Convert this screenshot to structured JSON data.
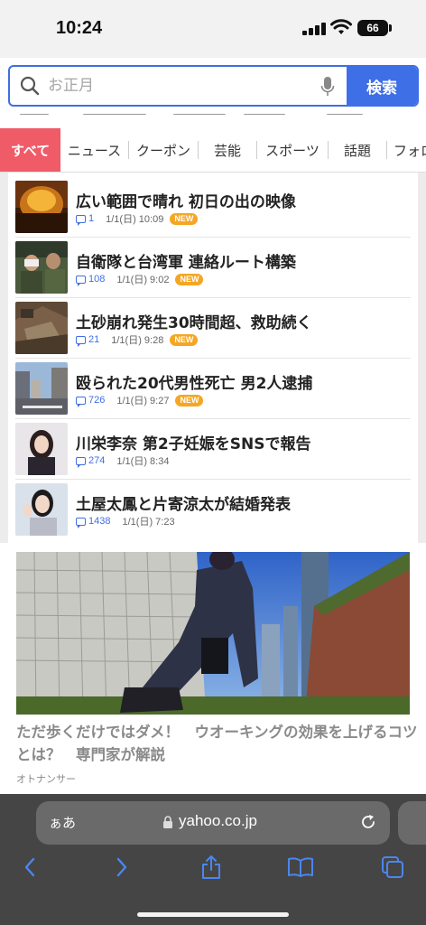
{
  "status_bar": {
    "time": "10:24",
    "battery": "66"
  },
  "search": {
    "placeholder": "お正月",
    "button_label": "検索"
  },
  "tabs": [
    {
      "label": "すべて",
      "active": true
    },
    {
      "label": "ニュース"
    },
    {
      "label": "クーポン"
    },
    {
      "label": "芸能"
    },
    {
      "label": "スポーツ"
    },
    {
      "label": "話題"
    },
    {
      "label": "フォロ"
    }
  ],
  "news": [
    {
      "title": "広い範囲で晴れ 初日の出の映像",
      "comments": "1",
      "date": "1/1(日) 10:09",
      "new": "NEW"
    },
    {
      "title": "自衛隊と台湾軍 連絡ルート構築",
      "comments": "108",
      "date": "1/1(日) 9:02",
      "new": "NEW"
    },
    {
      "title": "土砂崩れ発生30時間超、救助続く",
      "comments": "21",
      "date": "1/1(日) 9:28",
      "new": "NEW"
    },
    {
      "title": "殴られた20代男性死亡 男2人逮捕",
      "comments": "726",
      "date": "1/1(日) 9:27",
      "new": "NEW"
    },
    {
      "title": "川栄李奈 第2子妊娠をSNSで報告",
      "comments": "274",
      "date": "1/1(日) 8:34"
    },
    {
      "title": "土屋太鳳と片寄涼太が結婚発表",
      "comments": "1438",
      "date": "1/1(日) 7:23"
    }
  ],
  "feature": {
    "title": "ただ歩くだけではダメ！　ウオーキングの効果を上げるコツとは？　専門家が解説",
    "source": "オトナンサー"
  },
  "browser": {
    "aa_label": "ぁあ",
    "url": "yahoo.co.jp"
  },
  "colors": {
    "accent_blue": "#3f6fe6",
    "tab_active": "#ef5b67",
    "new_badge": "#f5a623"
  }
}
